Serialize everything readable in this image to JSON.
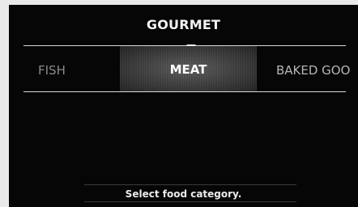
{
  "header": {
    "title": "GOURMET"
  },
  "carousel": {
    "items": [
      {
        "label": "FISH"
      },
      {
        "label": "MEAT"
      },
      {
        "label": "BAKED GOO"
      }
    ],
    "selected": "MEAT"
  },
  "footer": {
    "status": "Select food category."
  },
  "colors": {
    "background": "#060606",
    "text": "#ffffff",
    "dim_text": "#8a8a8a"
  }
}
